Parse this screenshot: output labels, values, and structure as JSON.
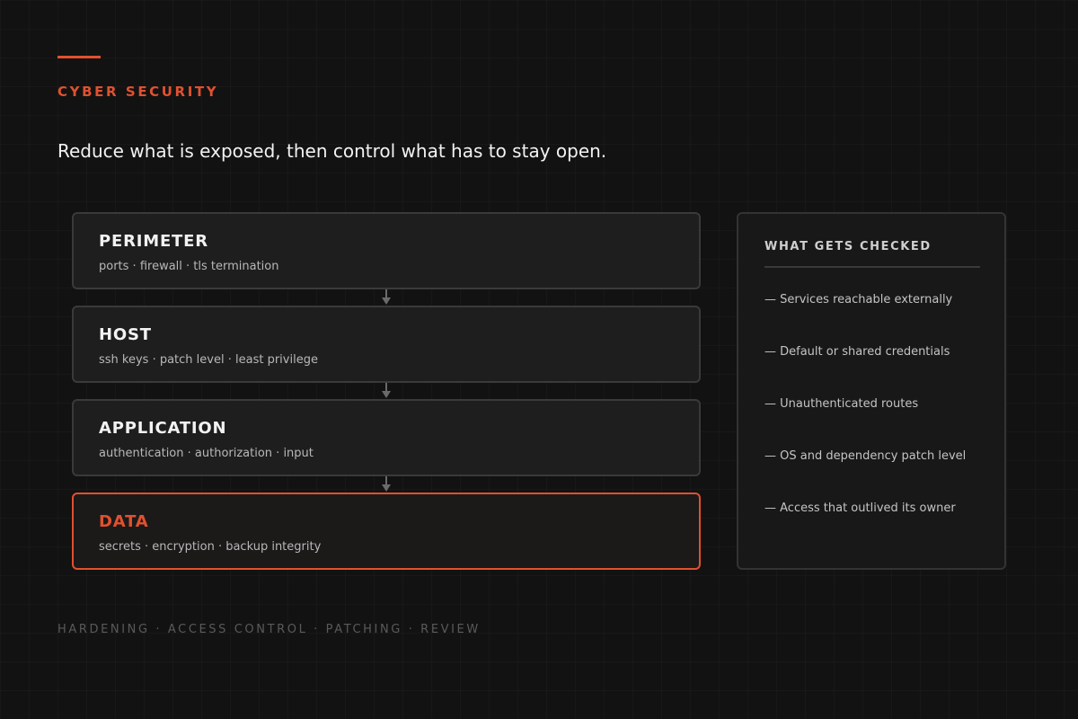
{
  "header": {
    "eyebrow": "CYBER SECURITY",
    "headline": "Reduce what is exposed, then control what has to stay open."
  },
  "layers": [
    {
      "name": "PERIMETER",
      "detail": "ports · firewall · tls termination"
    },
    {
      "name": "HOST",
      "detail": "ssh keys · patch level · least privilege"
    },
    {
      "name": "APPLICATION",
      "detail": "authentication · authorization · input"
    },
    {
      "name": "DATA",
      "detail": "secrets · encryption · backup integrity"
    }
  ],
  "checks": {
    "title": "WHAT GETS CHECKED",
    "items": [
      "— Services reachable externally",
      "— Default or shared credentials",
      "— Unauthenticated routes",
      "— OS and dependency patch level",
      "— Access that outlived its owner"
    ]
  },
  "footer": "HARDENING · ACCESS CONTROL · PATCHING · REVIEW",
  "colors": {
    "accent": "#e0512f",
    "background": "#121212",
    "card": "#1e1e1e",
    "card_border": "#3a3a3a",
    "connector": "#6a6a6a"
  }
}
